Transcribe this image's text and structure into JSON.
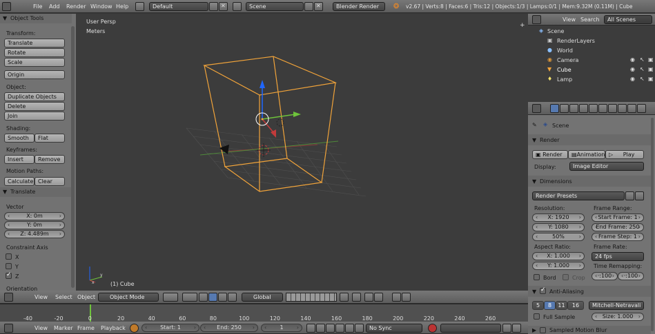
{
  "topbar": {
    "menus": [
      "File",
      "Add",
      "Render",
      "Window",
      "Help"
    ],
    "screen_layout": "Default",
    "scene": "Scene",
    "engine": "Blender Render",
    "stats": "v2.67 | Verts:8 | Faces:6 | Tris:12 | Objects:1/3 | Lamps:0/1 | Mem:9.32M (0.11M) | Cube"
  },
  "toolshelf": {
    "header": "Object Tools",
    "transform_label": "Transform:",
    "translate": "Translate",
    "rotate": "Rotate",
    "scale": "Scale",
    "origin": "Origin",
    "object_label": "Object:",
    "duplicate": "Duplicate Objects",
    "delete": "Delete",
    "join": "Join",
    "shading_label": "Shading:",
    "smooth": "Smooth",
    "flat": "Flat",
    "keyframes_label": "Keyframes:",
    "insert": "Insert",
    "remove": "Remove",
    "motion_label": "Motion Paths:",
    "calculate": "Calculate",
    "clear": "Clear"
  },
  "operator": {
    "header": "Translate",
    "vector_label": "Vector",
    "x": "X: 0m",
    "y": "Y: 0m",
    "z": "Z: 4.489m",
    "constraint_label": "Constraint Axis",
    "cx": "X",
    "cy": "Y",
    "cz": "Z",
    "orientation": "Orientation"
  },
  "viewport": {
    "view_name": "User Persp",
    "units": "Meters",
    "object_name": "(1) Cube"
  },
  "viewport_header": {
    "view": "View",
    "select": "Select",
    "object": "Object",
    "mode": "Object Mode",
    "orientation": "Global"
  },
  "timeline": {
    "ticks": [
      "-40",
      "-20",
      "0",
      "20",
      "40",
      "60",
      "80",
      "100",
      "120",
      "140",
      "160",
      "180",
      "200",
      "220",
      "240",
      "260"
    ],
    "view": "View",
    "marker": "Marker",
    "frame": "Frame",
    "playback": "Playback",
    "start": "Start: 1",
    "end": "End: 250",
    "current": "1",
    "sync": "No Sync"
  },
  "outliner": {
    "view": "View",
    "search": "Search",
    "filter": "All Scenes",
    "items": [
      "Scene",
      "RenderLayers",
      "World",
      "Camera",
      "Cube",
      "Lamp"
    ]
  },
  "properties": {
    "scene": "Scene",
    "render_header": "Render",
    "render_btn": "Render",
    "animation_btn": "Animation",
    "play_btn": "Play",
    "display_label": "Display:",
    "display_value": "Image Editor",
    "dimensions_header": "Dimensions",
    "presets": "Render Presets",
    "resolution_label": "Resolution:",
    "res_x": "X: 1920",
    "res_y": "Y: 1080",
    "res_pct": "50%",
    "frame_range_label": "Frame Range:",
    "start_frame": "Start Frame: 1",
    "end_frame": "End Frame: 250",
    "frame_step": "Frame Step: 1",
    "aspect_label": "Aspect Ratio:",
    "aspect_x": "X: 1.000",
    "aspect_y": "Y: 1.000",
    "frame_rate_label": "Frame Rate:",
    "fps": "24 fps",
    "remap_label": "Time Remapping:",
    "remap_old": "·:100",
    "remap_new": "·:100",
    "bord": "Bord",
    "crop": "Crop",
    "aa_header": "Anti-Aliasing",
    "aa_samples": [
      "5",
      "8",
      "11",
      "16"
    ],
    "aa_filter": "Mitchell-Netravali",
    "full_sample": "Full Sample",
    "size": "Size: 1.000",
    "motion_blur": "Sampled Motion Blur"
  },
  "colors": {
    "selected": "#f2a43a",
    "x_axis": "#c23b3b",
    "y_axis": "#6ec33b",
    "z_axis": "#1f66ff"
  }
}
